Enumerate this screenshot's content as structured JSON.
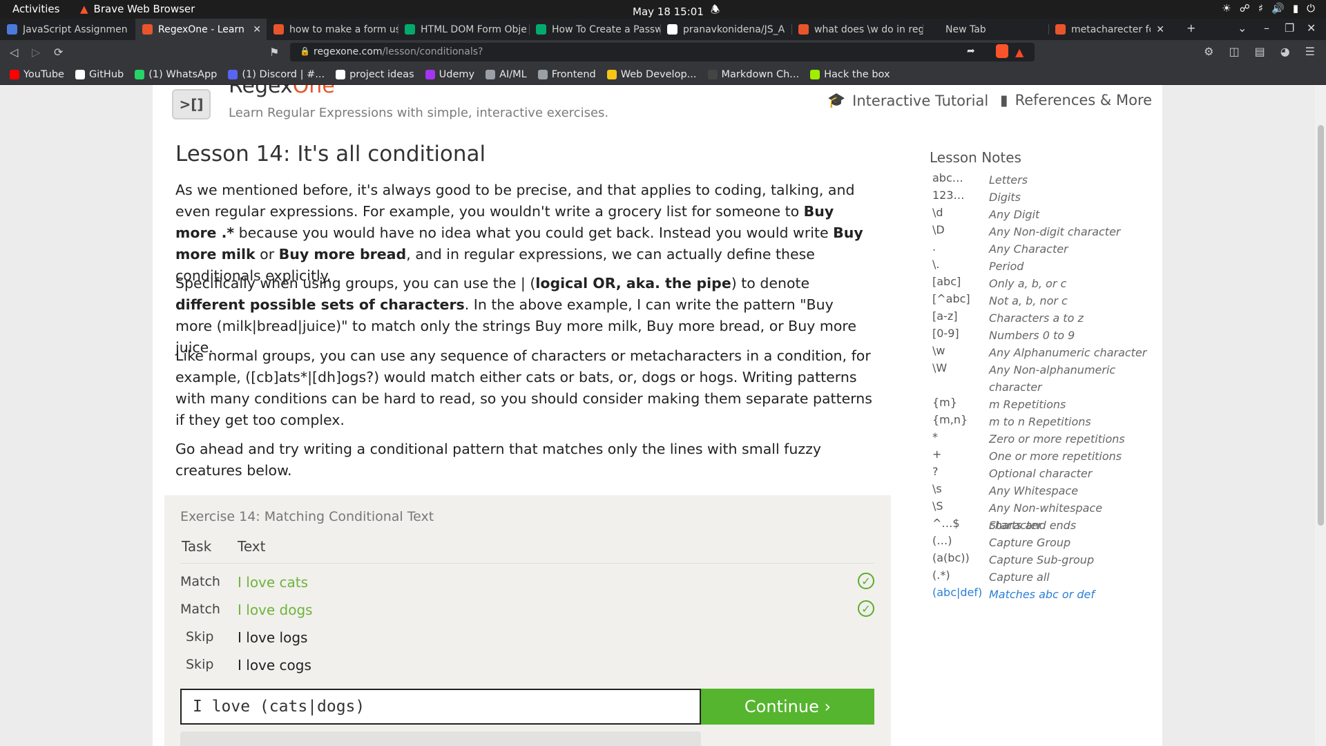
{
  "os": {
    "activities": "Activities",
    "app_name": "Brave Web Browser",
    "clock": "May 18  15:01"
  },
  "tabs": [
    {
      "title": "JavaScript Assignmen",
      "icon_color": "#4a7bdc"
    },
    {
      "title": "RegexOne - Learn R",
      "icon_color": "#e8552b",
      "active": true
    },
    {
      "title": "how to make a form us",
      "icon_color": "#e8552b"
    },
    {
      "title": "HTML DOM Form Obje",
      "icon_color": "#04aa6d"
    },
    {
      "title": "How To Create a Passw",
      "icon_color": "#04aa6d"
    },
    {
      "title": "pranavkonidena/JS_A",
      "icon_color": "#ffffff"
    },
    {
      "title": "what does \\w do in reg",
      "icon_color": "#e8552b"
    },
    {
      "title": "New Tab",
      "icon_color": "#202124"
    },
    {
      "title": "metacharecter for r",
      "icon_color": "#e8552b"
    }
  ],
  "address": {
    "domain": "regexone.com",
    "path": "/lesson/conditionals?"
  },
  "bookmarks": [
    {
      "label": "YouTube",
      "color": "#ff0000"
    },
    {
      "label": "GitHub",
      "color": "#ffffff"
    },
    {
      "label": "(1) WhatsApp",
      "color": "#25d366"
    },
    {
      "label": "(1) Discord | #...",
      "color": "#5865f2"
    },
    {
      "label": "project ideas",
      "color": "#ffffff"
    },
    {
      "label": "Udemy",
      "color": "#a435f0"
    },
    {
      "label": "AI/ML",
      "color": "#9aa0a6"
    },
    {
      "label": "Frontend",
      "color": "#9aa0a6"
    },
    {
      "label": "Web Develop...",
      "color": "#f5c518"
    },
    {
      "label": "Markdown Ch...",
      "color": "#444444"
    },
    {
      "label": "Hack the box",
      "color": "#9fef00"
    }
  ],
  "site": {
    "title_main": "Regex",
    "title_accent": "One",
    "tagline": "Learn Regular Expressions with simple, interactive exercises.",
    "nav_tutorial": "Interactive Tutorial",
    "nav_references": "References & More"
  },
  "lesson": {
    "title": "Lesson 14: It's all conditional",
    "p1": [
      {
        "t": "As we mentioned before, it's always good to be precise, and that applies to coding, talking, and even regular expressions. For example, you wouldn't write a grocery list for someone to ",
        "b": false
      },
      {
        "t": "Buy more .*",
        "b": true
      },
      {
        "t": " because you would have no idea what you could get back. Instead you would write ",
        "b": false
      },
      {
        "t": "Buy more milk",
        "b": true
      },
      {
        "t": " or ",
        "b": false
      },
      {
        "t": "Buy more bread",
        "b": true
      },
      {
        "t": ", and in regular expressions, we can actually define these conditionals explicitly.",
        "b": false
      }
    ],
    "p2": [
      {
        "t": "Specifically when using groups, you can use the | (",
        "b": false
      },
      {
        "t": "logical OR, aka. the pipe",
        "b": true
      },
      {
        "t": ") to denote ",
        "b": false
      },
      {
        "t": "different possible sets of characters",
        "b": true
      },
      {
        "t": ". In the above example, I can write the pattern \"Buy more (milk|bread|juice)\" to match only the strings Buy more milk, Buy more bread, or Buy more juice.",
        "b": false
      }
    ],
    "p3": [
      {
        "t": "Like normal groups, you can use any sequence of characters or metacharacters in a condition, for example, ([cb]ats*|[dh]ogs?) would match either cats or bats, or, dogs or hogs. Writing patterns with many conditions can be hard to read, so you should consider making them separate patterns if they get too complex.",
        "b": false
      }
    ],
    "p4": [
      {
        "t": "Go ahead and try writing a conditional pattern that matches only the lines with small fuzzy creatures below.",
        "b": false
      }
    ]
  },
  "exercise": {
    "title": "Exercise 14: Matching Conditional Text",
    "col_task": "Task",
    "col_text": "Text",
    "rows": [
      {
        "task": "Match",
        "text": "I love cats",
        "matched": true
      },
      {
        "task": "Match",
        "text": "I love dogs",
        "matched": true
      },
      {
        "task": "Skip",
        "text": "I love logs",
        "matched": false
      },
      {
        "task": "Skip",
        "text": "I love cogs",
        "matched": false
      }
    ],
    "answer": "I love (cats|dogs)",
    "continue_label": "Continue ›"
  },
  "notes": {
    "title": "Lesson Notes",
    "items": [
      {
        "k": "abc…",
        "v": "Letters"
      },
      {
        "k": "123…",
        "v": "Digits"
      },
      {
        "k": "\\d",
        "v": "Any Digit"
      },
      {
        "k": "\\D",
        "v": "Any Non-digit character"
      },
      {
        "k": ".",
        "v": "Any Character"
      },
      {
        "k": "\\.",
        "v": "Period"
      },
      {
        "k": "[abc]",
        "v": "Only a, b, or c"
      },
      {
        "k": "[^abc]",
        "v": "Not a, b, nor c"
      },
      {
        "k": "[a-z]",
        "v": "Characters a to z"
      },
      {
        "k": "[0-9]",
        "v": "Numbers 0 to 9"
      },
      {
        "k": "\\w",
        "v": "Any Alphanumeric character"
      },
      {
        "k": "\\W",
        "v": "Any Non-alphanumeric character",
        "tall": true
      },
      {
        "k": "{m}",
        "v": "m Repetitions"
      },
      {
        "k": "{m,n}",
        "v": "m to n Repetitions"
      },
      {
        "k": "*",
        "v": "Zero or more repetitions"
      },
      {
        "k": "+",
        "v": "One or more repetitions"
      },
      {
        "k": "?",
        "v": "Optional character"
      },
      {
        "k": "\\s",
        "v": "Any Whitespace"
      },
      {
        "k": "\\S",
        "v": "Any Non-whitespace character"
      },
      {
        "k": "^…$",
        "v": "Starts and ends"
      },
      {
        "k": "(…)",
        "v": "Capture Group"
      },
      {
        "k": "(a(bc))",
        "v": "Capture Sub-group"
      },
      {
        "k": "(.*)",
        "v": "Capture all"
      },
      {
        "k": "(abc|def)",
        "v": "Matches abc or def",
        "highlight": true
      }
    ]
  },
  "colors": {
    "accent": "#e8552b",
    "success": "#55b52e",
    "link": "#2a7fd6"
  }
}
